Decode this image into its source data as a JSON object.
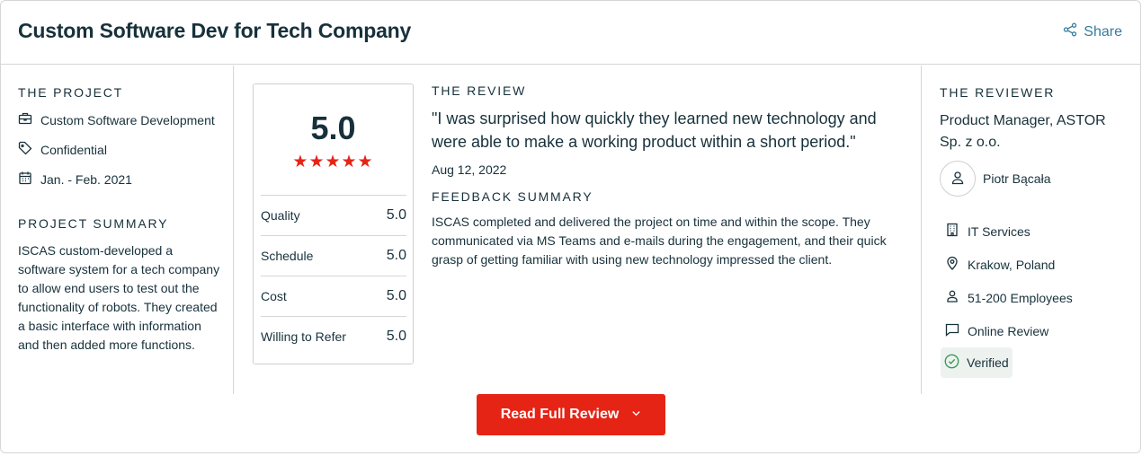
{
  "header": {
    "title": "Custom Software Dev for Tech Company",
    "share_label": "Share"
  },
  "project": {
    "label": "THE PROJECT",
    "service": "Custom Software Development",
    "budget": "Confidential",
    "dates": "Jan. - Feb. 2021",
    "summary_label": "PROJECT SUMMARY",
    "summary": "ISCAS custom-developed a software system for a tech company to allow end users to test out the functionality of robots. They created a basic interface with information and then added more functions."
  },
  "rating": {
    "overall": "5.0",
    "stars": "★★★★★",
    "star_count": 5,
    "rows": [
      {
        "label": "Quality",
        "value": "5.0"
      },
      {
        "label": "Schedule",
        "value": "5.0"
      },
      {
        "label": "Cost",
        "value": "5.0"
      },
      {
        "label": "Willing to Refer",
        "value": "5.0"
      }
    ]
  },
  "review": {
    "label": "THE REVIEW",
    "quote": "\"I was surprised how quickly they learned new technology and were able to make a working product within a short period.\"",
    "date": "Aug 12, 2022",
    "feedback_label": "FEEDBACK SUMMARY",
    "feedback": "ISCAS completed and delivered the project on time and within the scope. They communicated via MS Teams and e-mails during the engagement, and their quick grasp of getting familiar with using new technology impressed the client."
  },
  "reviewer": {
    "label": "THE REVIEWER",
    "title": "Product Manager, ASTOR Sp. z o.o.",
    "name": "Piotr Bącała",
    "industry": "IT Services",
    "location": "Krakow, Poland",
    "size": "51-200 Employees",
    "review_type": "Online Review",
    "verified": "Verified"
  },
  "cta": {
    "label": "Read Full Review"
  },
  "colors": {
    "accent": "#e62415",
    "link": "#367b9c",
    "text": "#17313b",
    "verified": "#3a9b5a"
  }
}
